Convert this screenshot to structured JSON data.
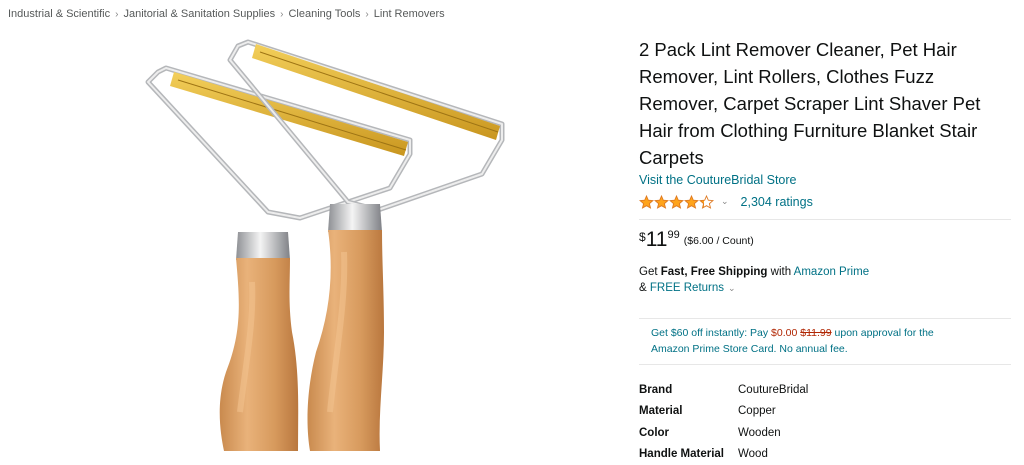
{
  "breadcrumb": [
    "Industrial & Scientific",
    "Janitorial & Sanitation Supplies",
    "Cleaning Tools",
    "Lint Removers"
  ],
  "product": {
    "title": "2 Pack Lint Remover Cleaner, Pet Hair Remover, Lint Rollers, Clothes Fuzz Remover, Carpet Scraper Lint Shaver Pet Hair from Clothing Furniture Blanket Stair Carpets",
    "store_link": "Visit the CoutureBridal Store",
    "rating": 4.3,
    "rating_count": "2,304 ratings",
    "price": {
      "symbol": "$",
      "whole": "11",
      "fraction": "99",
      "unit_price": "($6.00 / Count)"
    },
    "shipping": {
      "prefix": "Get ",
      "bold": "Fast, Free Shipping",
      "with": " with ",
      "prime": "Amazon Prime",
      "returns_prefix": "& ",
      "returns": "FREE Returns"
    },
    "promo": {
      "line1_a": "Get $60 off instantly: Pay ",
      "pay": "$0.00",
      "old_price": "$11.99",
      "line1_b": " upon approval for the",
      "line2": "Amazon Prime Store Card. No annual fee."
    },
    "specs": [
      {
        "key": "Brand",
        "value": "CoutureBridal"
      },
      {
        "key": "Material",
        "value": "Copper"
      },
      {
        "key": "Color",
        "value": "Wooden"
      },
      {
        "key": "Handle Material",
        "value": "Wood"
      }
    ]
  },
  "colors": {
    "link": "#007185",
    "price_red": "#B12704",
    "star": "#FFA41C"
  },
  "icons": {
    "star": "star-icon",
    "chevron": "chevron-down-icon",
    "breadcrumb_separator": "chevron-right-icon"
  }
}
